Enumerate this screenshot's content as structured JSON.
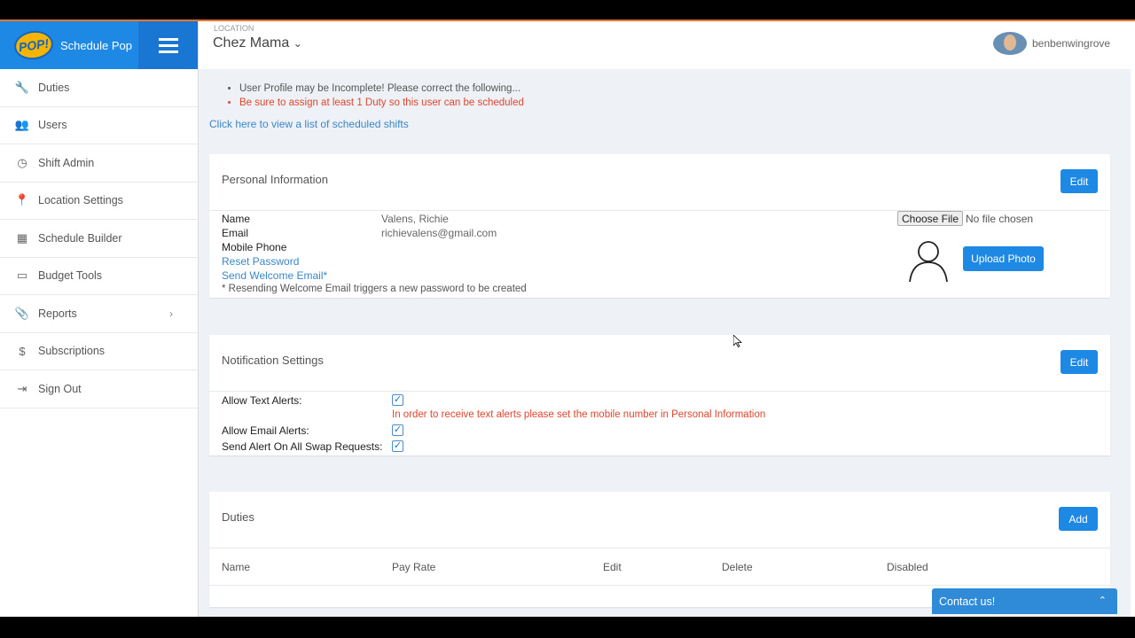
{
  "brand": {
    "name": "Schedule Pop",
    "logo_text": "POP!"
  },
  "sidebar": {
    "items": [
      {
        "label": "Duties",
        "icon": "wrench-icon",
        "glyph": "🔧"
      },
      {
        "label": "Users",
        "icon": "users-icon",
        "glyph": "👥"
      },
      {
        "label": "Shift Admin",
        "icon": "clock-icon",
        "glyph": "◷"
      },
      {
        "label": "Location Settings",
        "icon": "map-marker-icon",
        "glyph": "📍"
      },
      {
        "label": "Schedule Builder",
        "icon": "calendar-icon",
        "glyph": "▦"
      },
      {
        "label": "Budget Tools",
        "icon": "money-icon",
        "glyph": "▭"
      },
      {
        "label": "Reports",
        "icon": "paperclip-icon",
        "glyph": "📎"
      },
      {
        "label": "Subscriptions",
        "icon": "dollar-icon",
        "glyph": "$"
      },
      {
        "label": "Sign Out",
        "icon": "sign-out-icon",
        "glyph": "⇥"
      }
    ]
  },
  "header": {
    "location_label": "LOCATION",
    "location_name": "Chez Mama",
    "location_caret": "⌄",
    "username": "benbenwingrove"
  },
  "alerts": {
    "warning": "User Profile may be Incomplete! Please correct the following...",
    "error": "Be sure to assign at least 1 Duty so this user can be scheduled"
  },
  "shifts_link": "Click here to view a list of scheduled shifts",
  "personal": {
    "title": "Personal Information",
    "edit_label": "Edit",
    "name_label": "Name",
    "name_value": "Valens, Richie",
    "email_label": "Email",
    "email_value": "richievalens@gmail.com",
    "phone_label": "Mobile Phone",
    "reset_password": "Reset Password",
    "send_welcome": "Send Welcome Email*",
    "footnote": "* Resending Welcome Email triggers a new password to be created",
    "choose_file": "Choose File",
    "no_file": "No file chosen",
    "upload_label": "Upload Photo"
  },
  "notifications": {
    "title": "Notification Settings",
    "edit_label": "Edit",
    "text_alerts_label": "Allow Text Alerts:",
    "text_alerts_warning": "In order to receive text alerts please set the mobile number in Personal Information",
    "email_alerts_label": "Allow Email Alerts:",
    "swap_alerts_label": "Send Alert On All Swap Requests:",
    "checkmark": "✓"
  },
  "duties": {
    "title": "Duties",
    "add_label": "Add",
    "columns": [
      "Name",
      "Pay Rate",
      "Edit",
      "Delete",
      "Disabled"
    ]
  },
  "contact": {
    "label": "Contact us!",
    "chevron": "⌃"
  },
  "colors": {
    "primary": "#1e88e5",
    "error": "#e2452d",
    "link": "#3a87c8",
    "accent_line": "#e8732a"
  }
}
